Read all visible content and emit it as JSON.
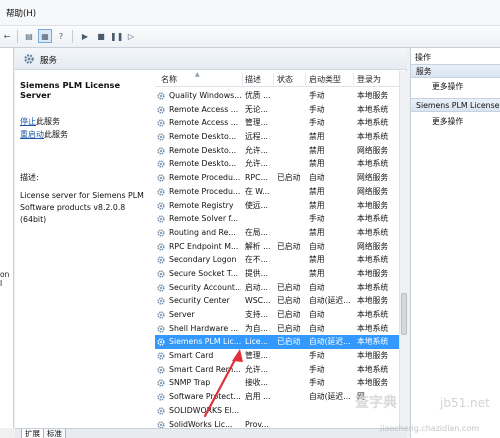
{
  "menubar": {
    "help": "帮助(H)"
  },
  "toolbar": {
    "buttons": [
      {
        "name": "back-button",
        "glyph": "←"
      },
      {
        "name": "properties-button",
        "glyph": "▤"
      },
      {
        "name": "show-hide-tree-button",
        "glyph": "▦"
      },
      {
        "name": "help-button",
        "glyph": "?"
      },
      {
        "name": "start-service-button",
        "glyph": "▶"
      },
      {
        "name": "stop-service-button",
        "glyph": "■"
      },
      {
        "name": "pause-service-button",
        "glyph": "❚❚"
      },
      {
        "name": "restart-service-button",
        "glyph": "▷"
      }
    ]
  },
  "left_stub": {
    "text": "on I"
  },
  "panel": {
    "title": "服务"
  },
  "description": {
    "service_name": "Siemens PLM License Server",
    "stop_link": "停止",
    "stop_rest": "此服务",
    "restart_link": "重启动",
    "restart_rest": "此服务",
    "heading": "描述:",
    "body": "License server for Siemens PLM Software products v8.2.0.8 (64bit)"
  },
  "columns": {
    "name": "名称",
    "desc": "描述",
    "status": "状态",
    "startup": "启动类型",
    "logon": "登录为"
  },
  "rows": [
    {
      "name": "Quality Windows...",
      "desc": "优质 ...",
      "status": "",
      "startup": "手动",
      "logon": "本地服务"
    },
    {
      "name": "Remote Access ...",
      "desc": "无论...",
      "status": "",
      "startup": "手动",
      "logon": "本地系统"
    },
    {
      "name": "Remote Access ...",
      "desc": "管理...",
      "status": "",
      "startup": "手动",
      "logon": "本地系统"
    },
    {
      "name": "Remote Deskto...",
      "desc": "远程...",
      "status": "",
      "startup": "禁用",
      "logon": "本地系统"
    },
    {
      "name": "Remote Deskto...",
      "desc": "允许...",
      "status": "",
      "startup": "禁用",
      "logon": "网络服务"
    },
    {
      "name": "Remote Deskto...",
      "desc": "允许...",
      "status": "",
      "startup": "禁用",
      "logon": "本地系统"
    },
    {
      "name": "Remote Procedu...",
      "desc": "RPC...",
      "status": "已启动",
      "startup": "自动",
      "logon": "网络服务"
    },
    {
      "name": "Remote Procedu...",
      "desc": "在 W...",
      "status": "",
      "startup": "禁用",
      "logon": "网络服务"
    },
    {
      "name": "Remote Registry",
      "desc": "使远...",
      "status": "",
      "startup": "禁用",
      "logon": "本地服务"
    },
    {
      "name": "Remote Solver f...",
      "desc": "",
      "status": "",
      "startup": "手动",
      "logon": "本地系统"
    },
    {
      "name": "Routing and Re...",
      "desc": "在局...",
      "status": "",
      "startup": "禁用",
      "logon": "本地系统"
    },
    {
      "name": "RPC Endpoint M...",
      "desc": "解析 ...",
      "status": "已启动",
      "startup": "自动",
      "logon": "网络服务"
    },
    {
      "name": "Secondary Logon",
      "desc": "在不...",
      "status": "",
      "startup": "禁用",
      "logon": "本地系统"
    },
    {
      "name": "Secure Socket T...",
      "desc": "提供...",
      "status": "",
      "startup": "禁用",
      "logon": "本地服务"
    },
    {
      "name": "Security Account...",
      "desc": "启动...",
      "status": "已启动",
      "startup": "自动",
      "logon": "本地系统"
    },
    {
      "name": "Security Center",
      "desc": "WSC...",
      "status": "已启动",
      "startup": "自动(延迟...",
      "logon": "本地服务"
    },
    {
      "name": "Server",
      "desc": "支持...",
      "status": "已启动",
      "startup": "自动",
      "logon": "本地系统"
    },
    {
      "name": "Shell Hardware ...",
      "desc": "为自...",
      "status": "已启动",
      "startup": "自动",
      "logon": "本地系统"
    },
    {
      "name": "Siemens PLM Lic...",
      "desc": "Lice...",
      "status": "已启动",
      "startup": "自动(延迟...",
      "logon": "本地系统",
      "selected": true
    },
    {
      "name": "Smart Card",
      "desc": "管理...",
      "status": "",
      "startup": "手动",
      "logon": "本地服务"
    },
    {
      "name": "Smart Card Rem...",
      "desc": "允许...",
      "status": "",
      "startup": "手动",
      "logon": "本地系统"
    },
    {
      "name": "SNMP Trap",
      "desc": "接收...",
      "status": "",
      "startup": "手动",
      "logon": "本地服务"
    },
    {
      "name": "Software Protect...",
      "desc": "启用 ...",
      "status": "",
      "startup": "自动(延迟...",
      "logon": "网"
    },
    {
      "name": "SOLIDWORKS El...",
      "desc": "",
      "status": "",
      "startup": "",
      "logon": ""
    },
    {
      "name": "SolidWorks Lic...",
      "desc": "Prov...",
      "status": "",
      "startup": "",
      "logon": ""
    }
  ],
  "tabs": [
    {
      "label": "扩展"
    },
    {
      "label": "标准"
    }
  ],
  "actions": {
    "title": "操作",
    "section1": "服务",
    "section1_item": "更多操作",
    "section2": "Siemens PLM License S",
    "section2_item": "更多操作"
  },
  "watermark": {
    "text1": "查字典",
    "text2": "jb51.net",
    "text3": "jiaocheng.chazidian.com"
  },
  "colors": {
    "selection": "#3399ff",
    "link": "#1a55a8",
    "arrow": "#e0313b"
  }
}
